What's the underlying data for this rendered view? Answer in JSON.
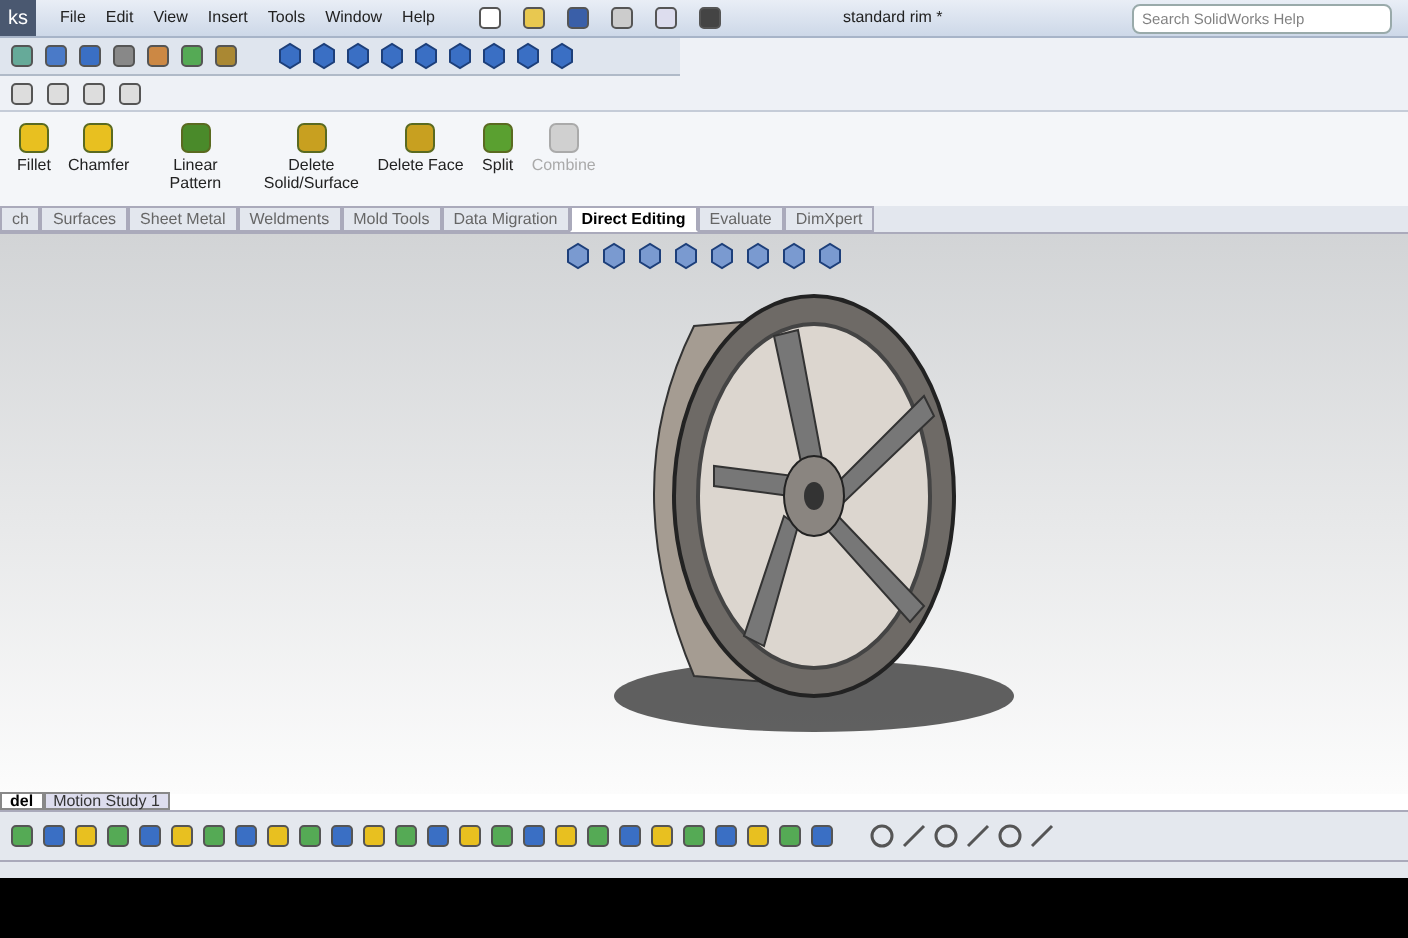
{
  "title_bar": {
    "app_name": "ks",
    "menu": [
      "File",
      "Edit",
      "View",
      "Insert",
      "Tools",
      "Window",
      "Help"
    ],
    "document_title": "standard rim *",
    "search": {
      "placeholder": "Search SolidWorks Help"
    }
  },
  "command_manager": {
    "buttons": [
      {
        "label": "Fillet",
        "disabled": false
      },
      {
        "label": "Chamfer",
        "disabled": false
      },
      {
        "label": "Linear Pattern",
        "disabled": false
      },
      {
        "label": "Delete Solid/Surface",
        "disabled": false
      },
      {
        "label": "Delete Face",
        "disabled": false
      },
      {
        "label": "Split",
        "disabled": false
      },
      {
        "label": "Combine",
        "disabled": true
      }
    ],
    "tabs": [
      {
        "label": "ch",
        "selected": false
      },
      {
        "label": "Surfaces",
        "selected": false
      },
      {
        "label": "Sheet Metal",
        "selected": false
      },
      {
        "label": "Weldments",
        "selected": false
      },
      {
        "label": "Mold Tools",
        "selected": false
      },
      {
        "label": "Data Migration",
        "selected": false
      },
      {
        "label": "Direct Editing",
        "selected": true
      },
      {
        "label": "Evaluate",
        "selected": false
      },
      {
        "label": "DimXpert",
        "selected": false
      }
    ]
  },
  "bottom_tabs": [
    {
      "label": "del",
      "selected": true
    },
    {
      "label": "Motion Study 1",
      "selected": false
    }
  ]
}
